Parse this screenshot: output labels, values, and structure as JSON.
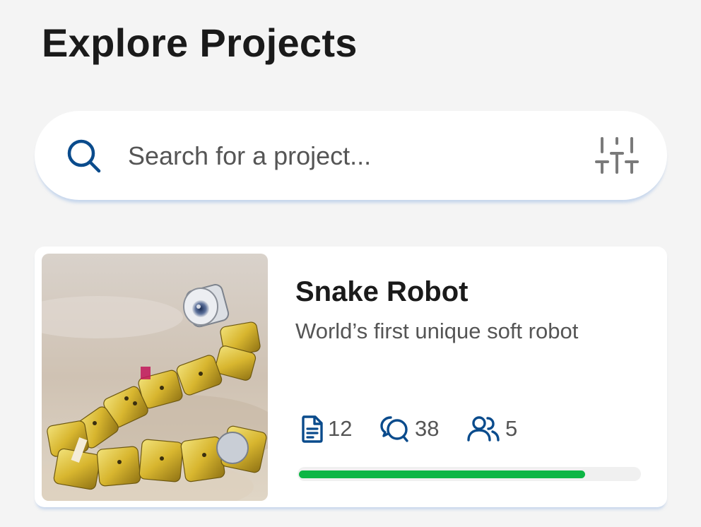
{
  "header": {
    "title": "Explore Projects"
  },
  "search": {
    "placeholder": "Search for a project...",
    "value": "",
    "icon": "search-icon",
    "filter_icon": "sliders-icon"
  },
  "projects": [
    {
      "title": "Snake Robot",
      "description": "World’s first unique soft robot",
      "image": "snake-robot-photo",
      "stats": {
        "documents": "12",
        "comments": "38",
        "members": "5"
      },
      "progress": 0.84
    }
  ],
  "colors": {
    "accent": "#0a4b8c",
    "progress": "#0db645",
    "icon_gray": "#7a7a7a"
  }
}
